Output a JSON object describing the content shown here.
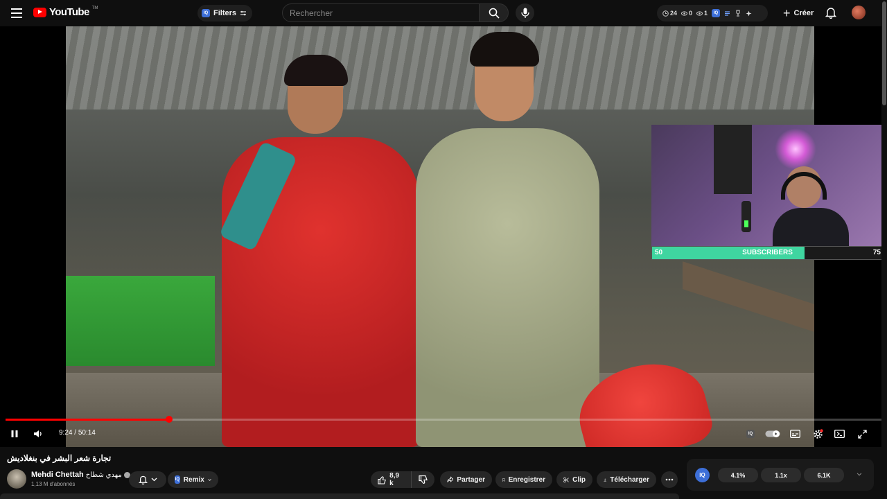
{
  "header": {
    "logo_text": "YouTube",
    "logo_tm": "TM",
    "filters_label": "Filters",
    "search_placeholder": "Rechercher",
    "stats": {
      "watch": "24",
      "views": "0",
      "seen": "1"
    },
    "create_label": "Créer"
  },
  "player": {
    "time_current": "9:24",
    "time_total": "50:14",
    "time_separator": " / ",
    "progress_fraction": 0.187,
    "subscriber_goal": {
      "left": "50",
      "label": "SUBSCRIBERS",
      "right": "75",
      "fill_fraction": 0.66
    }
  },
  "video": {
    "title": "تجارة شعر البشر في بنغلاديش",
    "channel_name": "Mehdi Chettah",
    "channel_name_ar": "مهدي شطاح",
    "subscribers": "1,13 M d'abonnés"
  },
  "actions": {
    "remix": "Remix",
    "likes": "8,9 k",
    "share": "Partager",
    "save": "Enregistrer",
    "clip": "Clip",
    "download": "Télécharger"
  },
  "extension": {
    "badge": "IQ",
    "values": [
      "4.1%",
      "1.1x",
      "6.1K"
    ]
  },
  "colors": {
    "brand": "#ff0000",
    "iq_blue": "#3d6fd8",
    "goal_fill": "#3fd5a0"
  }
}
